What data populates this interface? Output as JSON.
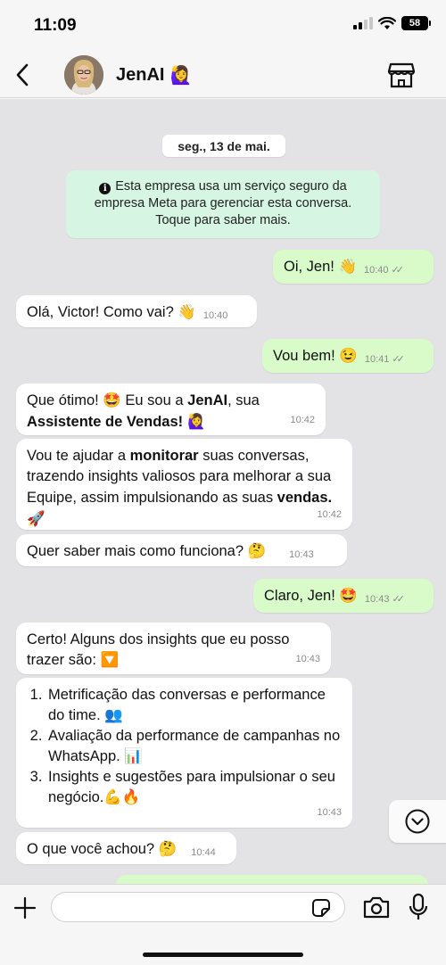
{
  "status_bar": {
    "time": "11:09",
    "battery": "58"
  },
  "header": {
    "contact_name": "JenAI",
    "contact_emoji": "🙋‍♀️"
  },
  "chat": {
    "date": "seg., 13 de mai.",
    "notice": "Esta empresa usa um serviço seguro da empresa Meta para gerenciar esta conversa. Toque para saber mais.",
    "messages": [
      {
        "text": "Oi, Jen! 👋",
        "time": "10:40"
      },
      {
        "text": "Olá, Victor! Como vai? 👋",
        "time": "10:40"
      },
      {
        "text": "Vou bem! 😉",
        "time": "10:41"
      },
      {
        "part1": "Que ótimo! 🤩 Eu sou a ",
        "bold1": "JenAI",
        "part2": ", sua ",
        "bold2": "Assistente de Vendas!",
        "part3": " 🙋‍♀️",
        "time": "10:42"
      },
      {
        "part1": "Vou te ajudar a ",
        "bold1": "monitorar",
        "part2": " suas conversas, trazendo insights valiosos para melhorar a sua Equipe, assim impulsionando as suas ",
        "bold2": "vendas.",
        "part3": " 🚀",
        "time": "10:42"
      },
      {
        "text": "Quer saber mais como funciona? 🤔",
        "time": "10:43"
      },
      {
        "text": "Claro, Jen! 🤩",
        "time": "10:43"
      },
      {
        "text": "Certo! Alguns dos insights que eu posso trazer são: 🔽",
        "time": "10:43"
      },
      {
        "items": [
          "Metrificação das conversas e performance do time. 👥",
          "Avaliação da performance de campanhas no WhatsApp. 📊",
          "Insights e sugestões para impulsionar o seu negócio.💪🔥"
        ],
        "time": "10:43"
      },
      {
        "text": "O que você achou? 🤔",
        "time": "10:44"
      }
    ]
  },
  "input": {
    "placeholder": "",
    "value": ""
  },
  "colors": {
    "chat_bg": "#e3e3e5",
    "outgoing_bubble": "#d8fbc9",
    "incoming_bubble": "#ffffff",
    "notice_bg": "#d6f5e2"
  }
}
